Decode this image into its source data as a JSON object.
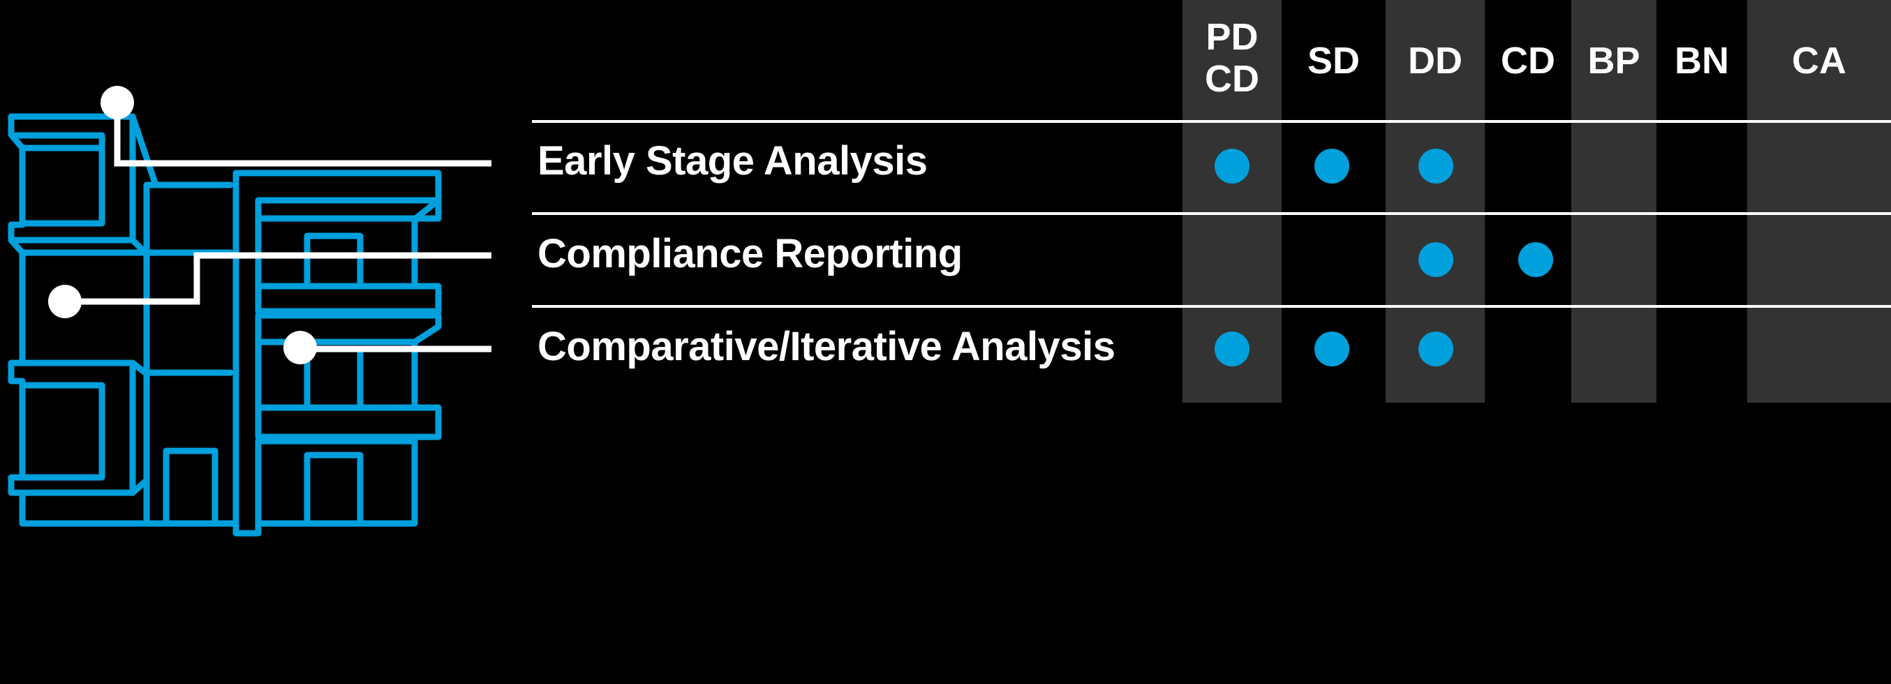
{
  "colors": {
    "accent": "#00A0DC",
    "column_shade": "#333333",
    "background": "#000000",
    "text": "#FFFFFF"
  },
  "illustration": {
    "icon": "building-outline-icon",
    "callouts": 3
  },
  "phases": [
    {
      "key": "pdcd",
      "label_line1": "PD",
      "label_line2": "CD",
      "shaded": true
    },
    {
      "key": "sd",
      "label_line1": "SD",
      "shaded": false
    },
    {
      "key": "dd",
      "label_line1": "DD",
      "shaded": true
    },
    {
      "key": "cd",
      "label_line1": "CD",
      "shaded": false
    },
    {
      "key": "bp",
      "label_line1": "BP",
      "shaded": true
    },
    {
      "key": "bn",
      "label_line1": "BN",
      "shaded": false
    },
    {
      "key": "ca",
      "label_line1": "CA",
      "shaded": true
    }
  ],
  "rows": [
    {
      "label": "Early Stage Analysis",
      "phases": [
        "pdcd",
        "sd",
        "dd"
      ]
    },
    {
      "label": "Compliance Reporting",
      "phases": [
        "dd",
        "cd"
      ]
    },
    {
      "label": "Comparative/Iterative Analysis",
      "phases": [
        "pdcd",
        "sd",
        "dd"
      ]
    }
  ]
}
